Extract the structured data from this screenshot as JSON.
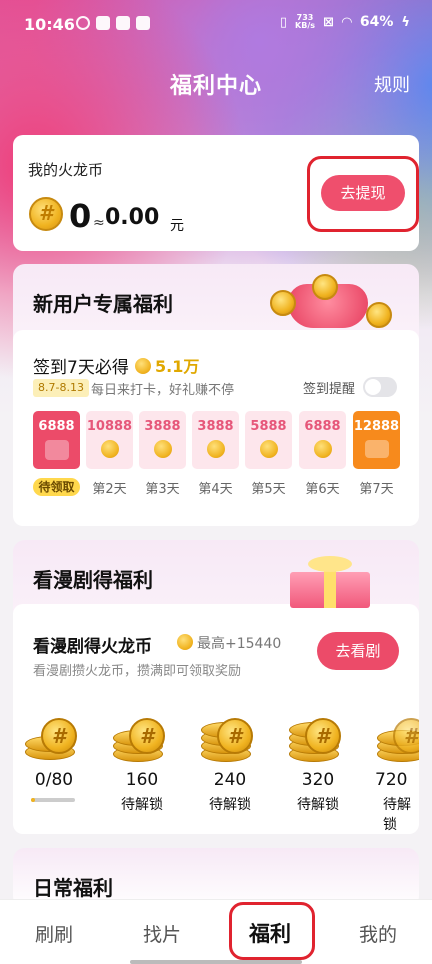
{
  "status_bar": {
    "time": "10:46",
    "net_speed_value": "733",
    "net_speed_unit": "KB/s",
    "battery": "64%"
  },
  "header": {
    "title": "福利中心",
    "rules": "规则"
  },
  "coin_card": {
    "title": "我的火龙币",
    "count": "0",
    "approx": "≈",
    "money": "0.00",
    "unit": "元",
    "withdraw": "去提现"
  },
  "new_user": {
    "title": "新用户专属福利",
    "checkin_title": "签到7天必得",
    "checkin_amount": "5.1万",
    "date_range": "8.7-8.13",
    "subtitle": "每日来打卡，好礼赚不停",
    "reminder": "签到提醒",
    "reminder_on": false,
    "days": [
      {
        "amount": "6888",
        "label": "待领取"
      },
      {
        "amount": "10888",
        "label": "第2天"
      },
      {
        "amount": "3888",
        "label": "第3天"
      },
      {
        "amount": "3888",
        "label": "第4天"
      },
      {
        "amount": "5888",
        "label": "第5天"
      },
      {
        "amount": "6888",
        "label": "第6天"
      },
      {
        "amount": "12888",
        "label": "第7天"
      }
    ]
  },
  "drama": {
    "section_title": "看漫剧得福利",
    "card_title": "看漫剧得火龙币",
    "max_reward": "最高+15440",
    "subtitle": "看漫剧攒火龙币，攒满即可领取奖励",
    "watch_button": "去看剧",
    "milestones": [
      {
        "value": "0/80",
        "status": "",
        "progress": 0.1
      },
      {
        "value": "160",
        "status": "待解锁"
      },
      {
        "value": "240",
        "status": "待解锁"
      },
      {
        "value": "320",
        "status": "待解锁"
      },
      {
        "value": "720",
        "status": "待解锁"
      }
    ]
  },
  "daily": {
    "title": "日常福利"
  },
  "tabs": [
    {
      "label": "刷刷",
      "active": false
    },
    {
      "label": "找片",
      "active": false
    },
    {
      "label": "福利",
      "active": true
    },
    {
      "label": "我的",
      "active": false
    }
  ],
  "colors": {
    "accent": "#ec4b69",
    "highlight_outline": "#e0232f",
    "coin_gold": "#f0b320"
  }
}
